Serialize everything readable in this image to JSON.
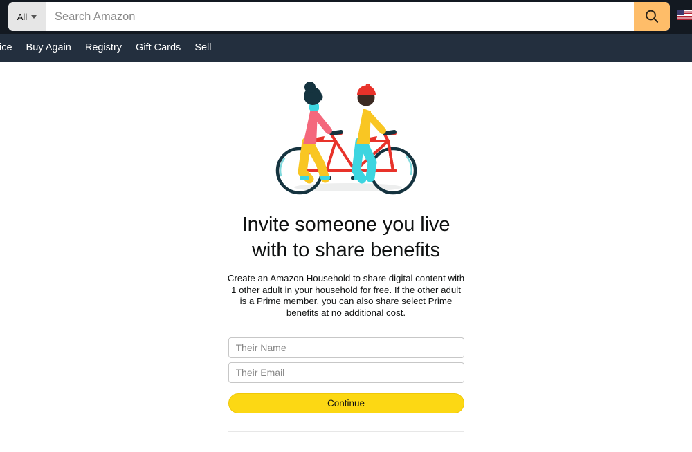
{
  "header": {
    "search": {
      "category_label": "All",
      "category_icon": "chevron-down-icon",
      "placeholder": "Search Amazon",
      "value": "",
      "search_icon": "search-icon"
    },
    "locale_flag": "us-flag-icon",
    "nav_items": [
      {
        "label": "ice"
      },
      {
        "label": "Buy Again"
      },
      {
        "label": "Registry"
      },
      {
        "label": "Gift Cards"
      },
      {
        "label": "Sell"
      }
    ]
  },
  "main": {
    "illustration_name": "tandem-bicycle-two-riders-illustration",
    "title": "Invite someone you live with to share benefits",
    "description": "Create an Amazon Household to share digital content with 1 other adult in your household for free. If the other adult is a Prime member, you can also share select Prime benefits at no additional cost.",
    "form": {
      "name_placeholder": "Their Name",
      "name_value": "",
      "email_placeholder": "Their Email",
      "email_value": "",
      "continue_label": "Continue"
    }
  },
  "colors": {
    "header_top_bg": "#131921",
    "header_nav_bg": "#232f3e",
    "search_button_bg": "#febd69",
    "continue_button_bg": "#fcd814",
    "text_primary": "#0f1111",
    "placeholder": "#868686",
    "illustration_red": "#e8322a",
    "illustration_yellow": "#f9c623",
    "illustration_cyan": "#3dd5e0",
    "illustration_pink": "#f4687c",
    "illustration_navy": "#15333f"
  }
}
